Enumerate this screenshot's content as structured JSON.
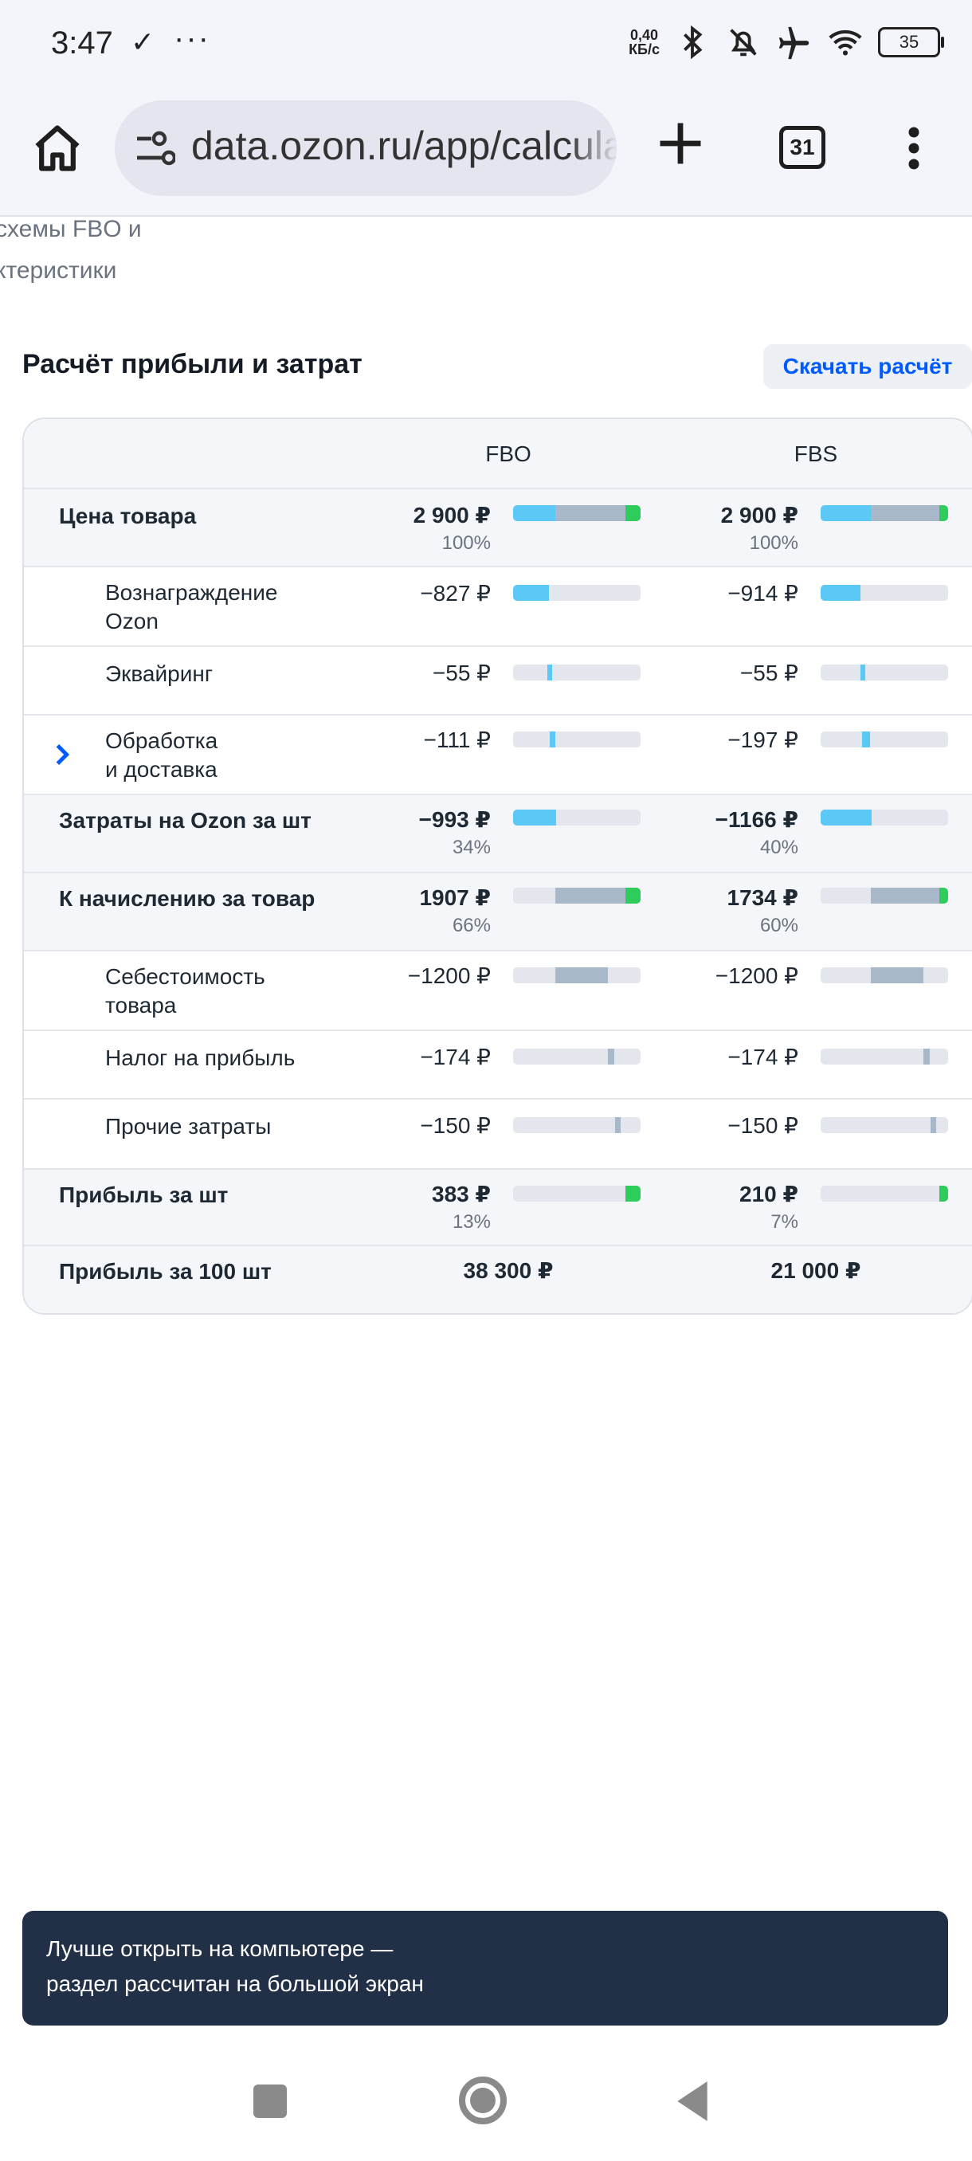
{
  "status_bar": {
    "time": "3:47",
    "check_icon": "✓",
    "dots": "···",
    "net_speed_value": "0,40",
    "net_speed_unit": "КБ/с",
    "battery": "35"
  },
  "browser": {
    "url": "data.ozon.ru/app/calcula",
    "tab_count": "31"
  },
  "intro": {
    "line1": "схемы FBO и",
    "line2": "ктеристики"
  },
  "section": {
    "title": "Расчёт прибыли и затрат",
    "download_label": "Скачать расчёт"
  },
  "table": {
    "columns": [
      "FBO",
      "FBS"
    ],
    "rows": [
      {
        "label": "Цена товара",
        "fbo": "2 900 ₽",
        "fbo_pct": "100%",
        "fbs": "2 900 ₽",
        "fbs_pct": "100%"
      },
      {
        "label": "Вознаграждение Ozon",
        "fbo": "−827 ₽",
        "fbs": "−914 ₽"
      },
      {
        "label": "Эквайринг",
        "fbo": "−55 ₽",
        "fbs": "−55 ₽"
      },
      {
        "label": "Обработка и доставка",
        "fbo": "−111 ₽",
        "fbs": "−197 ₽"
      },
      {
        "label": "Затраты на Ozon за шт",
        "fbo": "−993 ₽",
        "fbo_pct": "34%",
        "fbs": "−1166 ₽",
        "fbs_pct": "40%"
      },
      {
        "label": "К начислению за товар",
        "fbo": "1907 ₽",
        "fbo_pct": "66%",
        "fbs": "1734 ₽",
        "fbs_pct": "60%"
      },
      {
        "label": "Себестоимость товара",
        "fbo": "−1200 ₽",
        "fbs": "−1200 ₽"
      },
      {
        "label": "Налог на прибыль",
        "fbo": "−174 ₽",
        "fbs": "−174 ₽"
      },
      {
        "label": "Прочие затраты",
        "fbo": "−150 ₽",
        "fbs": "−150 ₽"
      },
      {
        "label": "Прибыль за шт",
        "fbo": "383 ₽",
        "fbo_pct": "13%",
        "fbs": "210 ₽",
        "fbs_pct": "7%"
      },
      {
        "label": "Прибыль за 100 шт",
        "fbo": "38 300 ₽",
        "fbs": "21 000 ₽"
      }
    ],
    "label_lines": {
      "reward_1": "Вознаграждение",
      "reward_2": "Ozon",
      "delivery_1": "Обработка",
      "delivery_2": "и доставка",
      "cost_1": "Себестоимость",
      "cost_2": "товара"
    }
  },
  "toast": {
    "line1": "Лучше открыть на компьютере —",
    "line2": "раздел рассчитан на большой экран"
  },
  "colors": {
    "accent": "#005bff",
    "bar_ozon": "#5cc8f5",
    "bar_costs": "#a9b8c8",
    "bar_profit": "#2ecc5a",
    "toast_bg": "#223047"
  },
  "icons": {
    "home": "home-icon",
    "site_settings": "tune-icon",
    "new_tab": "plus-icon",
    "tabs": "tabs-icon",
    "menu": "more-vert-icon",
    "expand": "chevron-right-icon"
  }
}
